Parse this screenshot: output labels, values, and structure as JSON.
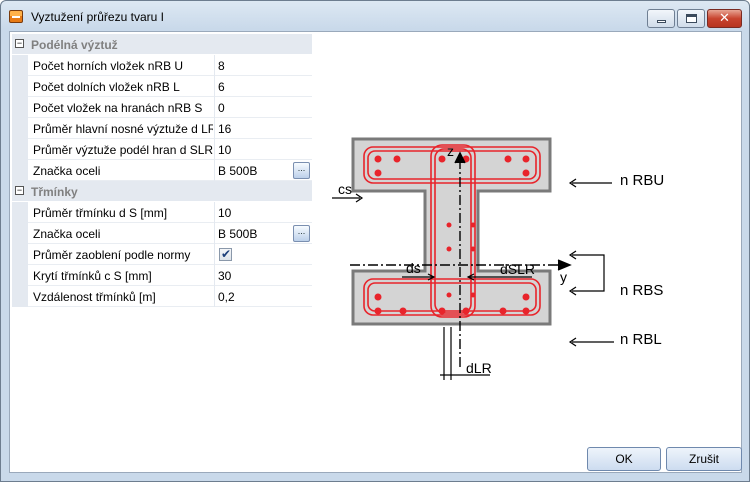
{
  "window": {
    "title": "Vyztužení průřezu tvaru I",
    "icon": "dialog-icon"
  },
  "properties": {
    "categories": [
      {
        "label": "Podélná výztuž",
        "toggle": "⊟",
        "rows": [
          {
            "name": "Počet horních vložek nRB U",
            "value": "8"
          },
          {
            "name": "Počet dolních vložek nRB L",
            "value": "6"
          },
          {
            "name": "Počet vložek na hranách nRB S",
            "value": "0"
          },
          {
            "name": "Průměr hlavní nosné výztuže d LR",
            "value": "16"
          },
          {
            "name": "Průměr výztuže podél hran d SLR",
            "value": "10"
          },
          {
            "name": "Značka oceli",
            "value": "B 500B",
            "button": "..."
          }
        ]
      },
      {
        "label": "Třmínky",
        "toggle": "⊟",
        "rows": [
          {
            "name": "Průměr třmínku d S [mm]",
            "value": "10"
          },
          {
            "name": "Značka oceli",
            "value": "B 500B",
            "button": "..."
          },
          {
            "name": "Průměr zaoblení podle normy",
            "value": "✔"
          },
          {
            "name": "Krytí třmínků c S [mm]",
            "value": "30"
          },
          {
            "name": "Vzdálenost třmínků [m]",
            "value": "0,2"
          }
        ]
      }
    ]
  },
  "diagram": {
    "labels": {
      "z": "z",
      "y": "y",
      "cs": "cs",
      "ds": "ds",
      "dslr": "dSLR",
      "dlr": "dLR",
      "rbu": "n RBU",
      "rbs": "n RBS",
      "rbl": "n RBL"
    }
  },
  "buttons": {
    "ok": "OK",
    "cancel": "Zrušit"
  },
  "colors": {
    "rebar": "#e8242b",
    "section_fill": "#d4d4d4",
    "section_stroke": "#7a7a7a",
    "category_bg": "#e4e9f0"
  }
}
